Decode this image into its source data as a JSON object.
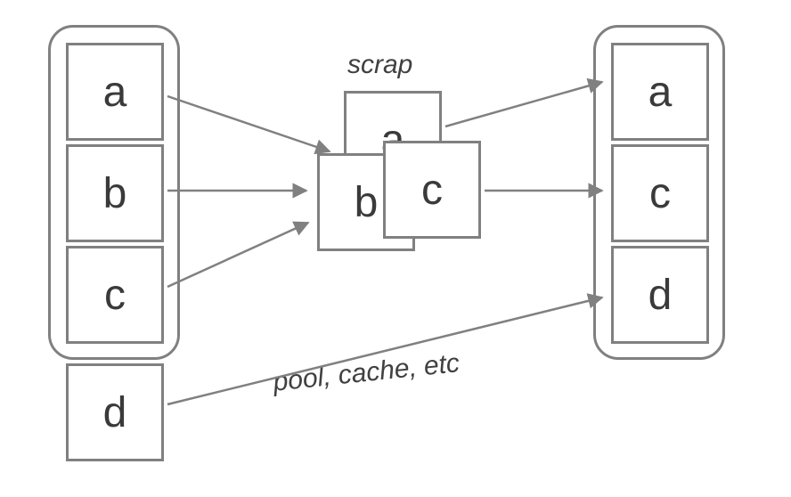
{
  "labels": {
    "scrap": "scrap",
    "pool": "pool, cache, etc"
  },
  "left": {
    "grouped": [
      "a",
      "b",
      "c"
    ],
    "extra": "d"
  },
  "center": {
    "back": "a",
    "mid": "b",
    "front": "c"
  },
  "right": {
    "grouped": [
      "a",
      "c",
      "d"
    ]
  },
  "colors": {
    "border": "#808080",
    "text": "#404040"
  }
}
